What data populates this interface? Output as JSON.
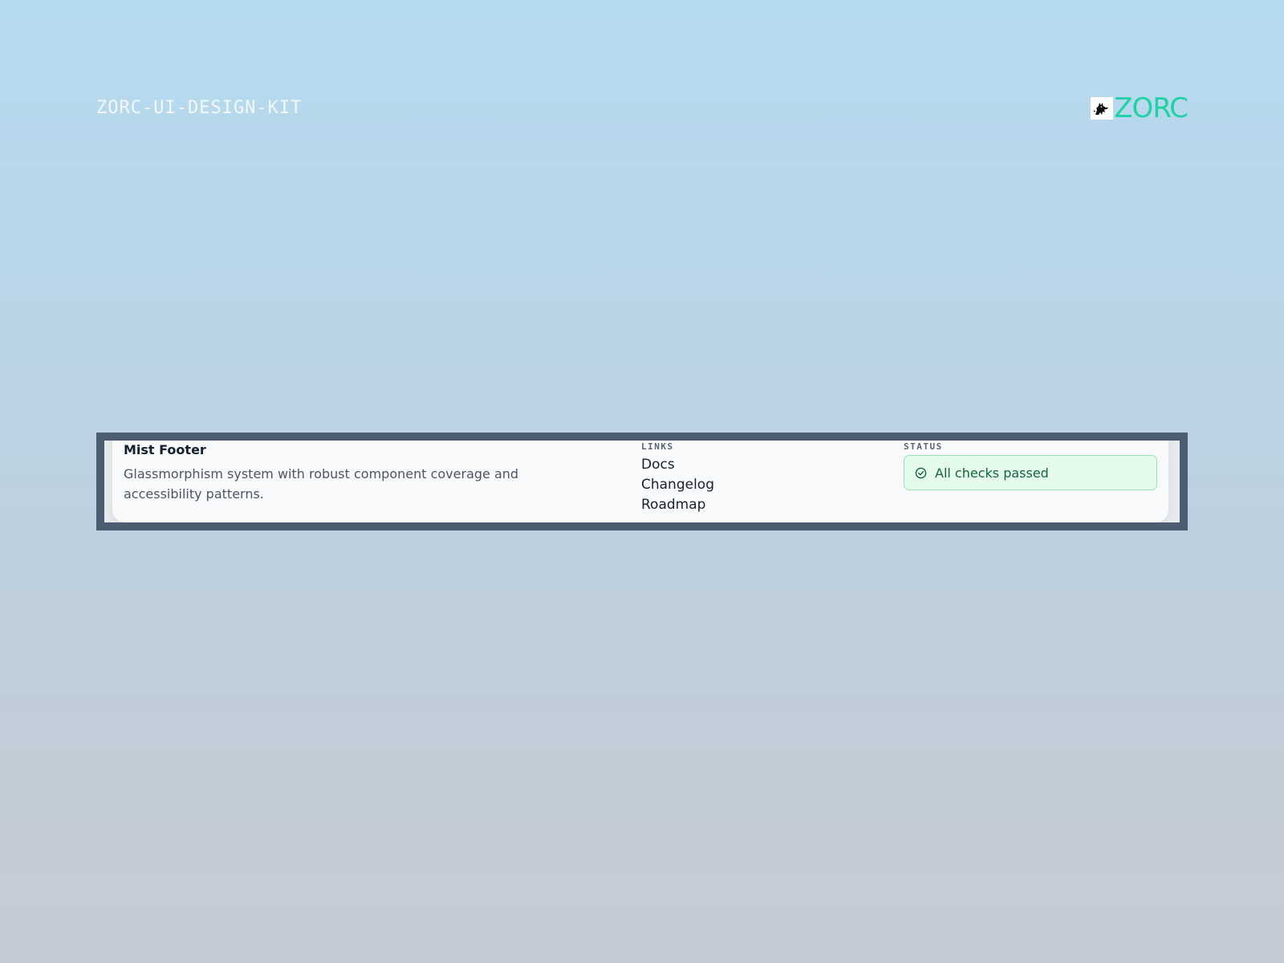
{
  "header": {
    "kit_label": "ZORC-UI-DESIGN-KIT",
    "brand_name": "ZORC",
    "brand_icon": "wolf-mascot-icon",
    "brand_color": "#1fd1a4"
  },
  "footer": {
    "title": "Mist Footer",
    "description": "Glassmorphism system with robust component coverage and accessibility patterns.",
    "links_heading": "LINKS",
    "links": [
      {
        "label": "Docs"
      },
      {
        "label": "Changelog"
      },
      {
        "label": "Roadmap"
      }
    ],
    "status_heading": "STATUS",
    "status": {
      "text": "All checks passed",
      "icon": "check-circle-icon",
      "color": "#15643a"
    }
  }
}
